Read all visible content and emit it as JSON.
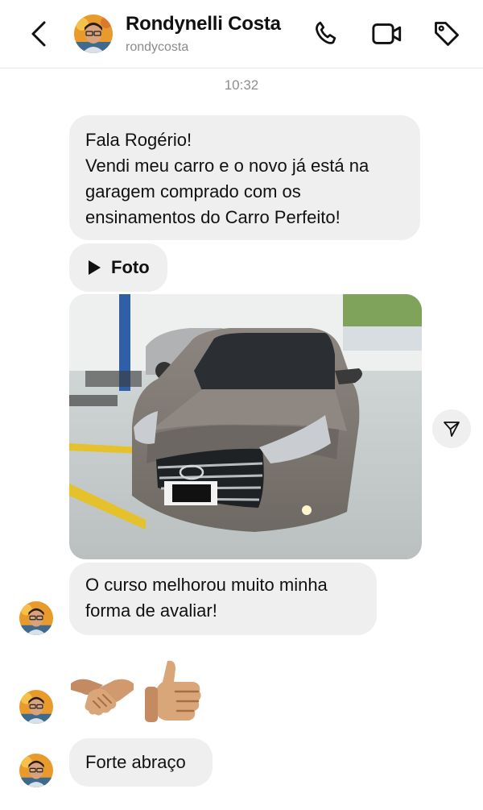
{
  "header": {
    "contact_name": "Rondynelli Costa",
    "username": "rondycosta",
    "icons": [
      "chevron-left-icon",
      "phone-icon",
      "video-camera-icon",
      "tag-icon"
    ]
  },
  "chat": {
    "timestamp": "10:32",
    "messages": [
      {
        "type": "text",
        "lines": [
          "Fala Rogério!",
          "Vendi meu carro e o novo já está na",
          "garagem comprado com os",
          "ensinamentos do Carro Perfeito!"
        ]
      },
      {
        "type": "media-label",
        "label": "Foto"
      },
      {
        "type": "photo",
        "subject": "car-photo"
      },
      {
        "type": "text",
        "lines": [
          "O curso melhorou muito minha",
          "forma de avaliar!"
        ]
      },
      {
        "type": "emoji",
        "emojis": [
          "handshake",
          "thumbs-up"
        ]
      },
      {
        "type": "text",
        "lines": [
          "Forte abraço"
        ]
      }
    ]
  },
  "colors": {
    "bubble": "#efefef",
    "muted_text": "#8e8e8e",
    "divider": "#e6e6e6"
  }
}
